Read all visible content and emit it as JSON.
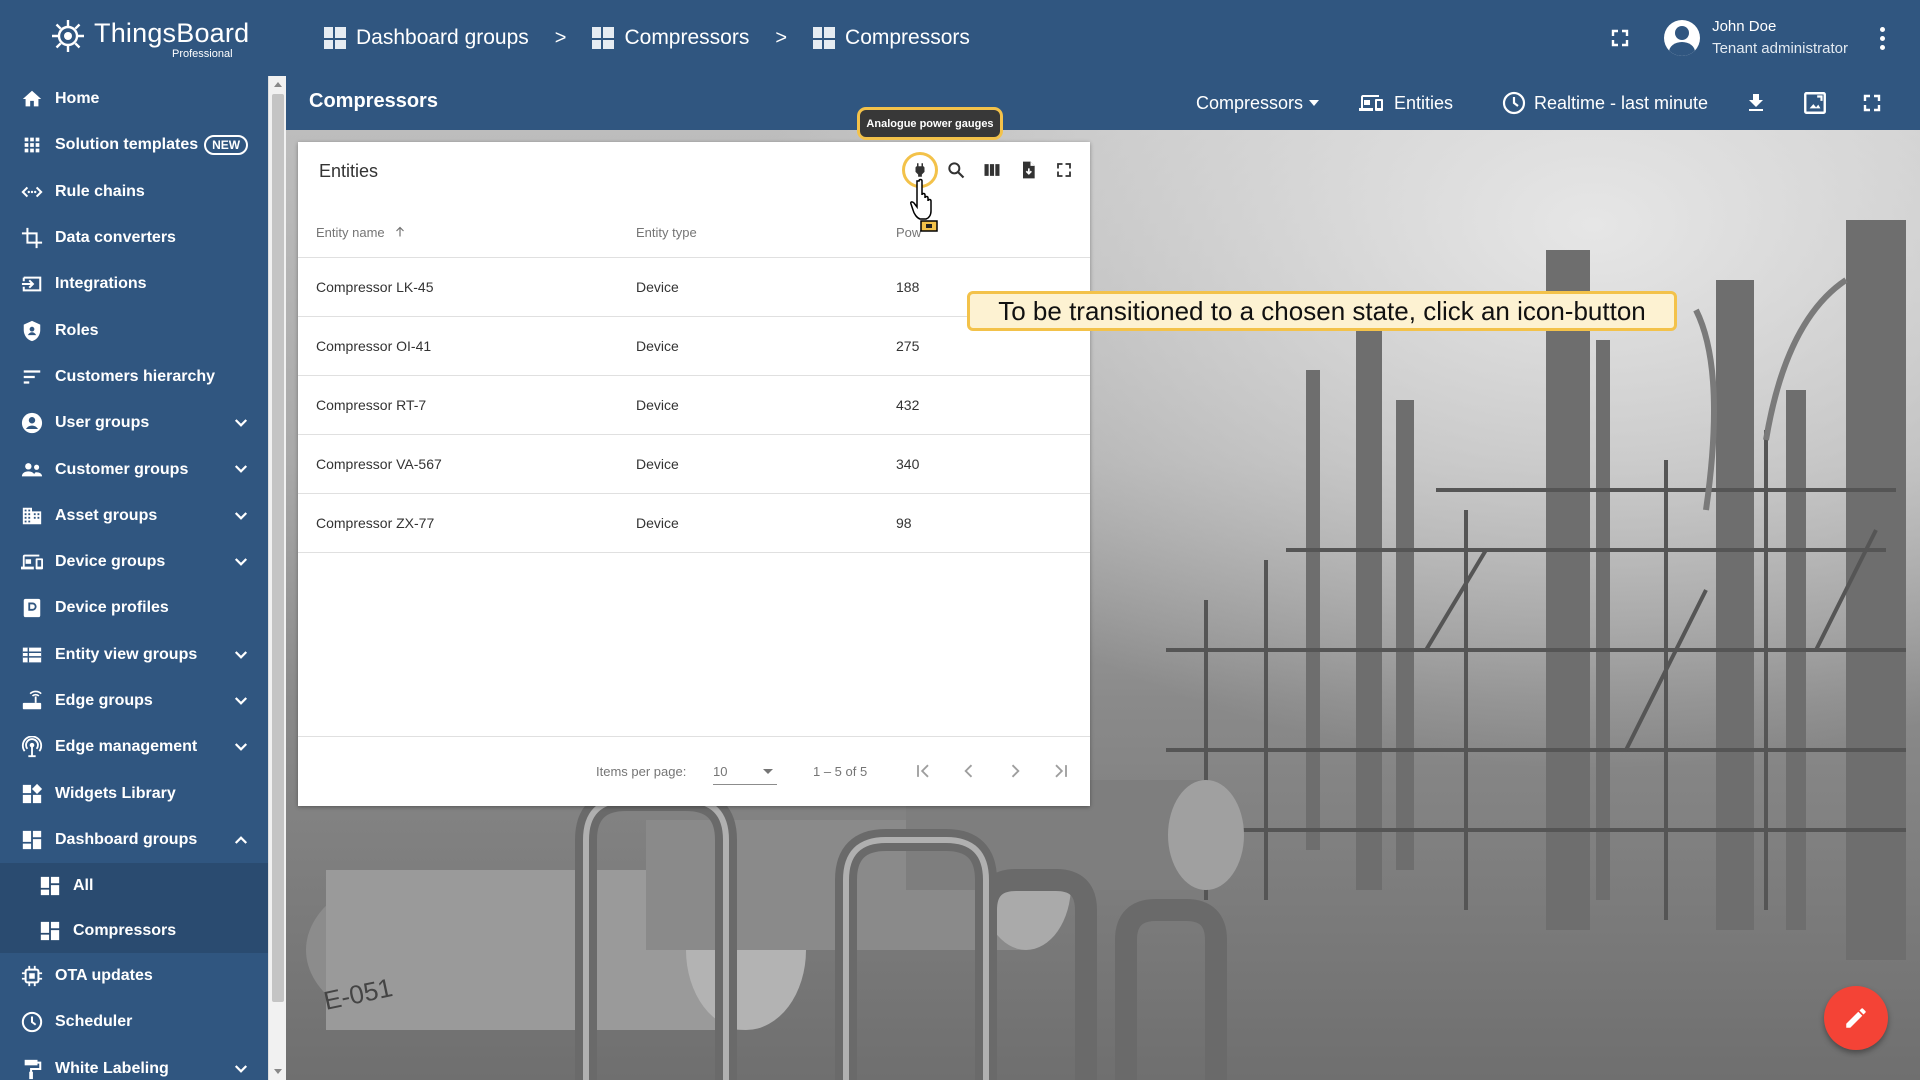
{
  "app": {
    "logo_name": "ThingsBoard",
    "logo_sub": "Professional",
    "brand_color": "#305680"
  },
  "breadcrumbs": [
    {
      "label": "Dashboard groups",
      "icon": "dashboard-icon"
    },
    {
      "label": "Compressors",
      "icon": "dashboard-icon"
    },
    {
      "label": "Compressors",
      "icon": "dashboard-icon"
    }
  ],
  "breadcrumb_separator": ">",
  "user": {
    "name": "John Doe",
    "role": "Tenant administrator"
  },
  "sidebar": {
    "items": [
      {
        "label": "Home",
        "icon": "home-icon"
      },
      {
        "label": "Solution templates",
        "icon": "apps-grid-icon",
        "badge": "NEW"
      },
      {
        "label": "Rule chains",
        "icon": "code-arrows-icon"
      },
      {
        "label": "Data converters",
        "icon": "crop-icon"
      },
      {
        "label": "Integrations",
        "icon": "input-icon"
      },
      {
        "label": "Roles",
        "icon": "shield-icon"
      },
      {
        "label": "Customers hierarchy",
        "icon": "sort-lines-icon"
      },
      {
        "label": "User groups",
        "icon": "account-circle-icon",
        "expandable": true
      },
      {
        "label": "Customer groups",
        "icon": "people-icon",
        "expandable": true
      },
      {
        "label": "Asset groups",
        "icon": "building-icon",
        "expandable": true
      },
      {
        "label": "Device groups",
        "icon": "devices-icon",
        "expandable": true
      },
      {
        "label": "Device profiles",
        "icon": "device-profile-icon"
      },
      {
        "label": "Entity view groups",
        "icon": "view-list-icon",
        "expandable": true
      },
      {
        "label": "Edge groups",
        "icon": "router-icon",
        "expandable": true
      },
      {
        "label": "Edge management",
        "icon": "settings-input-antenna-icon",
        "expandable": true
      },
      {
        "label": "Widgets Library",
        "icon": "widgets-icon"
      },
      {
        "label": "Dashboard groups",
        "icon": "dashboard-icon",
        "expanded": true
      },
      {
        "label": "All",
        "icon": "dashboard-icon",
        "sub": true
      },
      {
        "label": "Compressors",
        "icon": "dashboard-icon",
        "sub": true
      },
      {
        "label": "OTA updates",
        "icon": "memory-icon"
      },
      {
        "label": "Scheduler",
        "icon": "schedule-icon"
      },
      {
        "label": "White Labeling",
        "icon": "format-paint-icon",
        "expandable": true
      }
    ]
  },
  "dashboard": {
    "title": "Compressors",
    "state_select": "Compressors",
    "entities_button": "Entities",
    "timewindow": "Realtime - last minute"
  },
  "widget": {
    "title": "Entities",
    "columns": [
      "Entity name",
      "Entity type",
      "Pow"
    ],
    "rows": [
      {
        "name": "Compressor LK-45",
        "type": "Device",
        "power": "188"
      },
      {
        "name": "Compressor OI-41",
        "type": "Device",
        "power": "275"
      },
      {
        "name": "Compressor RT-7",
        "type": "Device",
        "power": "432"
      },
      {
        "name": "Compressor VA-567",
        "type": "Device",
        "power": "340"
      },
      {
        "name": "Compressor ZX-77",
        "type": "Device",
        "power": "98"
      }
    ],
    "pagination": {
      "items_per_page_label": "Items per page:",
      "items_per_page": "10",
      "range": "1 – 5 of 5"
    }
  },
  "tutorial": {
    "tooltip": "Analogue power gauges",
    "callout": "To be transitioned to a chosen state, click an icon-button",
    "highlight_color": "#f3c24a"
  }
}
